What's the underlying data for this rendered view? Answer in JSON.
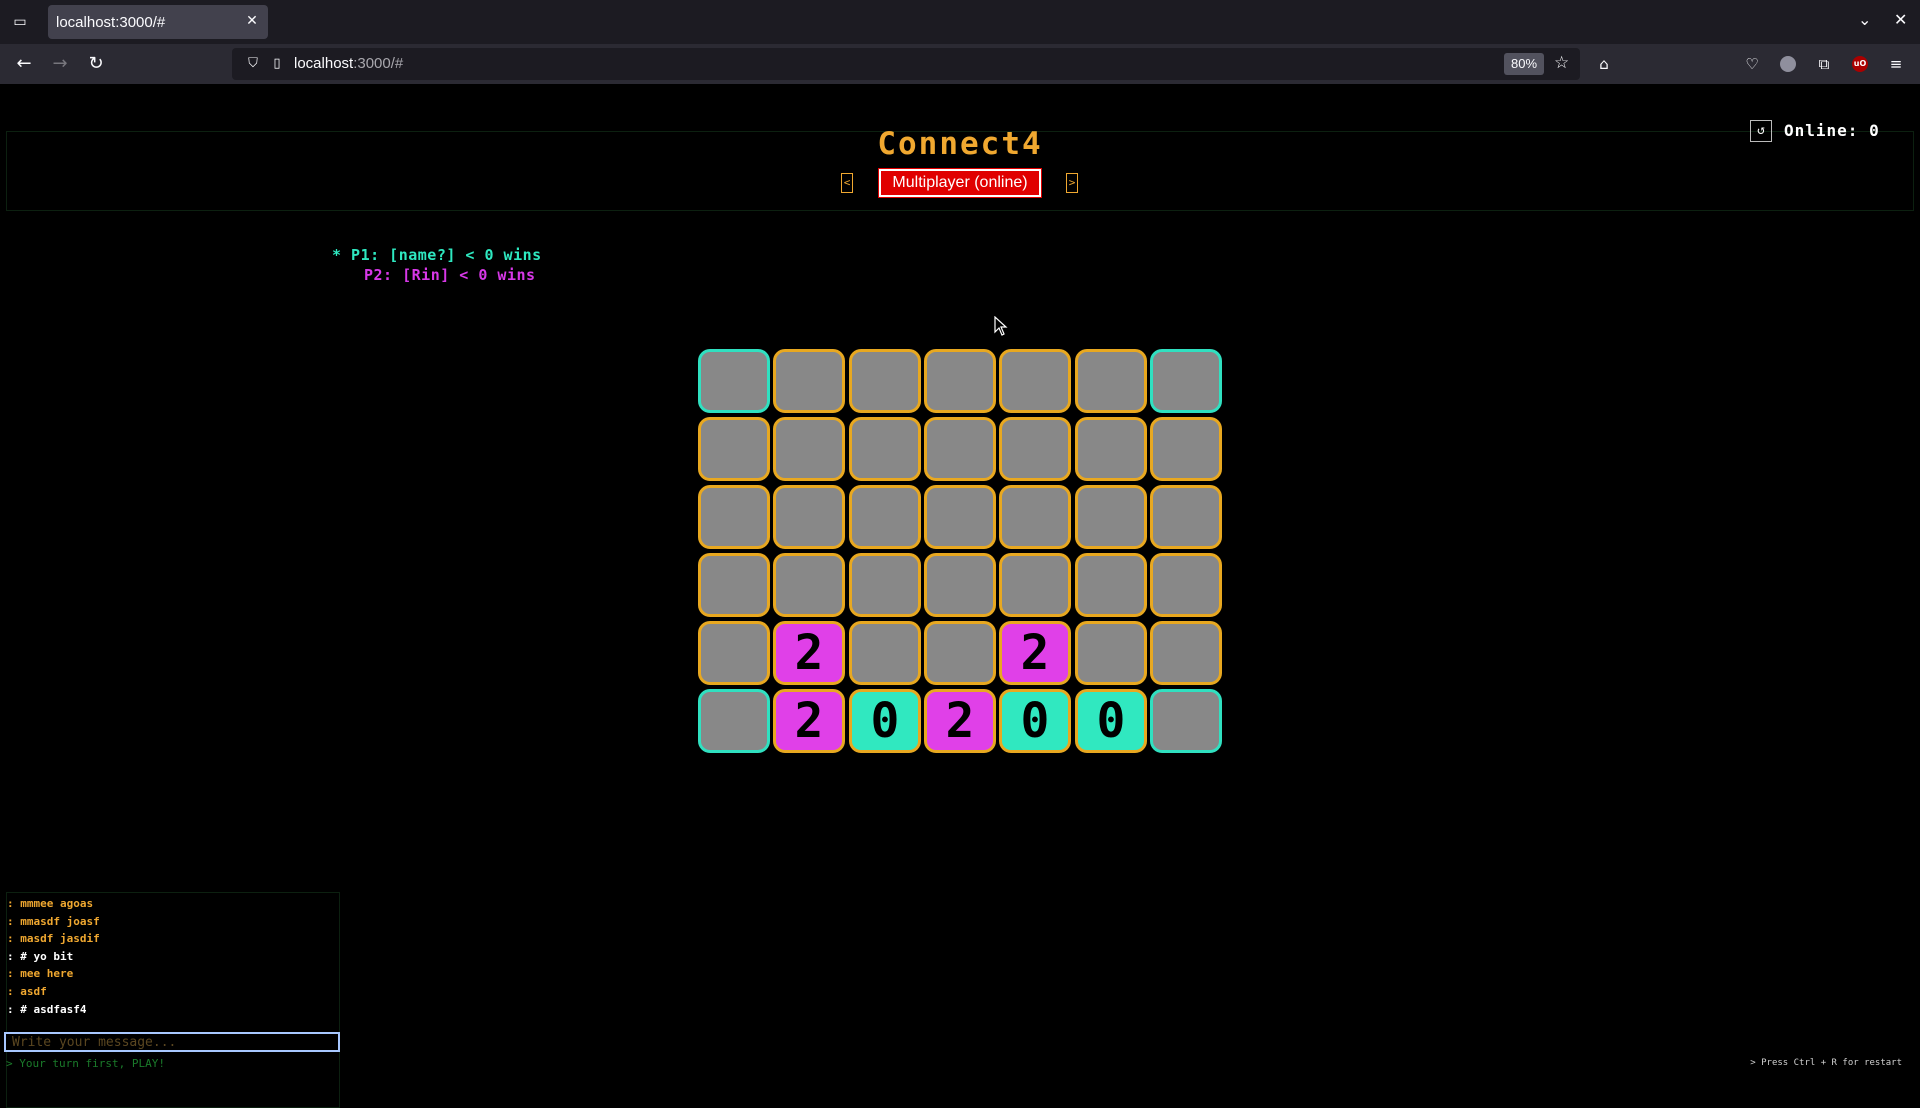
{
  "browser": {
    "tab_title": "localhost:3000/#",
    "url_host": "localhost",
    "url_rest": ":3000/#",
    "zoom": "80%"
  },
  "game": {
    "title": "Connect4",
    "mode": "Multiplayer (online)",
    "mode_prev": "<",
    "mode_next": ">",
    "online_label": "Online: 0",
    "p1": "* P1: [name?] < 0 wins",
    "p2": "P2: [Rin] < 0 wins",
    "board": [
      [
        "",
        "",
        "",
        "",
        "",
        "",
        ""
      ],
      [
        "",
        "",
        "",
        "",
        "",
        "",
        ""
      ],
      [
        "",
        "",
        "",
        "",
        "",
        "",
        ""
      ],
      [
        "",
        "",
        "",
        "",
        "",
        "",
        ""
      ],
      [
        "",
        "2",
        "",
        "",
        "2",
        "",
        ""
      ],
      [
        "",
        "2",
        "0",
        "2",
        "0",
        "0",
        ""
      ]
    ],
    "colors": {
      "empty": "#888888",
      "p1": "#30e8c0",
      "p2": "#e040e8",
      "border": "#e8a820",
      "edge_border": "#30e0c0"
    }
  },
  "chat": {
    "messages": [
      {
        "prefix": ":",
        "text": "mmmee agoas",
        "own": false
      },
      {
        "prefix": ":",
        "text": "mmasdf joasf",
        "own": false
      },
      {
        "prefix": ":",
        "text": "masdf jasdif",
        "own": false
      },
      {
        "prefix": ": #",
        "text": "yo bit",
        "own": true
      },
      {
        "prefix": ":",
        "text": "mee here",
        "own": false
      },
      {
        "prefix": ":",
        "text": "asdf",
        "own": false
      },
      {
        "prefix": ": #",
        "text": "asdfasf4",
        "own": true
      }
    ],
    "placeholder": "Write your message...",
    "status": "> Your turn first, PLAY!",
    "restart_hint": "> Press Ctrl + R for restart"
  }
}
